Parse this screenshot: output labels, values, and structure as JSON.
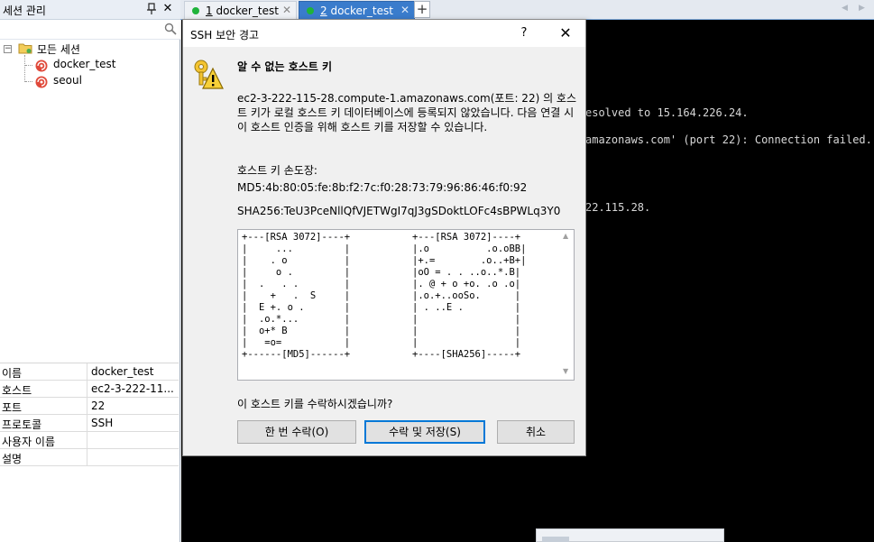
{
  "session_panel": {
    "title": "세션 관리",
    "pin_glyph": "ᴘ",
    "close_glyph": "✕",
    "search_placeholder": "",
    "tree": {
      "root_label": "모든 세션",
      "children": [
        {
          "label": "docker_test",
          "icon": "ssh-session-icon"
        },
        {
          "label": "seoul",
          "icon": "ssh-session-icon"
        }
      ]
    },
    "properties": [
      {
        "key": "이름",
        "value": "docker_test"
      },
      {
        "key": "호스트",
        "value": "ec2-3-222-11..."
      },
      {
        "key": "포트",
        "value": "22"
      },
      {
        "key": "프로토콜",
        "value": "SSH"
      },
      {
        "key": "사용자 이름",
        "value": ""
      },
      {
        "key": "설명",
        "value": ""
      }
    ]
  },
  "tabs": [
    {
      "index": "1",
      "label": "docker_test",
      "active": false
    },
    {
      "index": "2",
      "label": "docker_test",
      "active": true
    }
  ],
  "new_tab_glyph": "+",
  "terminal": {
    "lines": [
      "esolved to 15.164.226.24.",
      "amazonaws.com' (port 22): Connection failed.",
      "22.115.28."
    ]
  },
  "dialog": {
    "title": "SSH 보안 경고",
    "help_glyph": "?",
    "close_glyph": "✕",
    "heading": "알 수 없는 호스트 키",
    "message": "ec2-3-222-115-28.compute-1.amazonaws.com(포트: 22) 의 호스트 키가 로컬 호스트 키 데이터베이스에 등록되지 않았습니다. 다음 연결 시 이 호스트 인증을 위해 호스트 키를 저장할 수 있습니다.",
    "fingerprint_heading": "호스트 키 손도장:",
    "md5": "MD5:4b:80:05:fe:8b:f2:7c:f0:28:73:79:96:86:46:f0:92",
    "sha256": "SHA256:TeU3PceNllQfVJETWgI7qJ3gSDoktLOFc4sBPWLq3Y0",
    "randomart_rsa": "+---[RSA 3072]----+\n|     ...         |\n|    . o          |\n|     o .         |\n|  .   . .        |\n|    +   .  S     |\n|  E +. o .       |\n|  .o.*...        |\n|  o+* B          |\n|   =o=           |\n+------[MD5]------+",
    "randomart_sha": "+---[RSA 3072]----+\n|.o          .o.oBB|\n|+.=        .o..+B+|\n|oO = . . ..o..*.B|\n|. @ + o +o. .o .o|\n|.o.+..ooSo.      |\n| . ..E .         |\n|                 |\n|                 |\n|                 |\n+----[SHA256]-----+",
    "question": "이 호스트 키를 수락하시겠습니까?",
    "buttons": {
      "accept_once": "한 번 수락(O)",
      "accept_save": "수락 및 저장(S)",
      "cancel": "취소"
    }
  },
  "colors": {
    "active_tab": "#3a7ccc",
    "connected_dot": "#1fb33a",
    "terminal_bg": "#000000",
    "default_button_border": "#0078d7"
  }
}
